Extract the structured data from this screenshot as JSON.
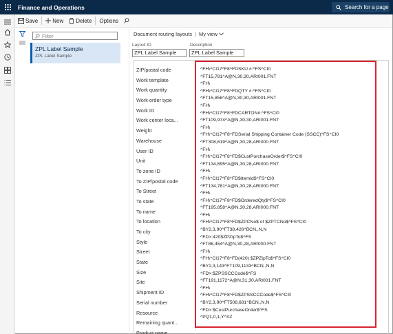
{
  "app": {
    "title": "Finance and Operations",
    "search_label": "Search for a page"
  },
  "actions": {
    "save": "Save",
    "new": "New",
    "delete": "Delete",
    "options": "Options"
  },
  "list": {
    "filter_placeholder": "Filter",
    "items": [
      {
        "title": "ZPL Label Sample",
        "subtitle": "ZPL Label Sample"
      }
    ]
  },
  "detail": {
    "breadcrumb": "Document routing layouts",
    "view": "My view",
    "layout_id_label": "Layout ID",
    "layout_id_value": "ZPL Label Sample",
    "description_label": "Description",
    "description_value": "ZPL Label Sample"
  },
  "fields": [
    "ZIP/postal code",
    "Work template",
    "Work quantity",
    "Work order type",
    "Work ID",
    "Work center loca...",
    "Weight",
    "Warehouse",
    "User ID",
    "Unit",
    "To zone ID",
    "To ZIP/postal code",
    "To Street",
    "To state",
    "To name",
    "To location",
    "To city",
    "Style",
    "Street",
    "State",
    "Size",
    "Site",
    "Shipment ID",
    "Serial number",
    "Resource",
    "Remaining quant...",
    "Product name"
  ],
  "code_lines": [
    "^FH\\^CI17^F8^FDSKU #:^FS^CI0",
    "^FT15,781^A@N,30,30,ARI001.FNT",
    "^FH\\",
    "^FH\\^CI17^F8^FDQTY #:^FS^CI0",
    "^FT15,858^A@N,30,30,ARI001.FNT",
    "^FH\\",
    "^FH\\^CI17^F8^FDCARTON#:^FS^CI0",
    "^FT109,974^A@N,30,30,ARI001.FNT",
    "^FH\\",
    "^FH\\^CI17^F8^FDSerial Shipping Container Code (SSCC)^FS^CI0",
    "^FT308,619^A@N,30,28,ARI000.FNT",
    "^FH\\",
    "^FH\\^CI17^F8^FD$CustPurchaseOrder$^FS^CI0",
    "^FT134,695^A@N,30,28,ARI000.FNT",
    "^FH\\",
    "^FH\\^CI17^F8^FD$ItemId$^FS^CI0",
    "^FT134,781^A@N,30,28,ARI000.FNT",
    "^FH\\",
    "^FH\\^CI17^F8^FD$OrderedQty$^FS^CI0",
    "^FT195,858^A@N,30,28,ARI000.FNT",
    "^FH\\",
    "^FH\\^CI17^F8^FD$ZPCNo$    of    $ZPTCNo$^FS^CI0",
    "^BY2,3,90^FT38,426^BCN,,N,N",
    "^FD>:420$ZPZipTo$^FS",
    "^FT86,454^A@N,30,28,ARI000.FNT",
    "^FH\\",
    "^FH\\^CI17^F8^FD(420) $ZPZipTo$^FS^CI0",
    "^BY2,3,143^FT109,1133^BCN,,N,N",
    "^FD>:$ZPSSCCCode$^FS",
    "^FT191,1172^A@N,31,30,ARI001.FNT",
    "^FH\\",
    "^FH\\^CI17^F8^FD$ZPSSCCCode$^FS^CI0",
    "^BY2,3,90^FT508,681^BCN,,N,N",
    "^FD>:$CustPurchaseOrder$^FS",
    "^PQ1,0,1,Y^XZ"
  ]
}
